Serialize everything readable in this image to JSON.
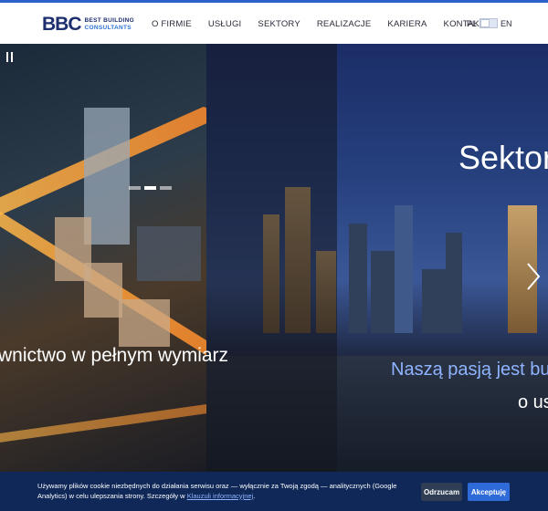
{
  "brand": {
    "mark": "BBC",
    "line1": "BEST BUILDING",
    "line2": "CONSULTANTS"
  },
  "nav": {
    "items": [
      "O FIRMIE",
      "USŁUGI",
      "SEKTORY",
      "REALIZACJE",
      "KARIERA",
      "KONTAKT"
    ]
  },
  "lang": {
    "left": "PL",
    "right": "EN"
  },
  "hero": {
    "left_headline": "wnictwo w pełnym wymiarz",
    "right_headline": "Sektor",
    "right_sub_1": "Naszą pasją jest budo",
    "right_sub_2": "o us"
  },
  "cookie": {
    "text": "Używamy plików cookie niezbędnych do działania serwisu oraz — wyłącznie za Twoją zgodą — analitycznych (Google Analytics) w celu ulepszania strony. Szczegóły w ",
    "link": "Klauzuli informacyjnej",
    "suffix": ".",
    "reject_label": "Odrzucam",
    "accept_label": "Akceptuję"
  },
  "colors": {
    "accent": "#2f6bd8",
    "brand_dark": "#1d2f6e",
    "cookie_bg": "#0f2858",
    "sub_highlight": "#8fb4ff"
  },
  "icons": {
    "pause": "pause-icon",
    "next": "chevron-right-icon"
  }
}
